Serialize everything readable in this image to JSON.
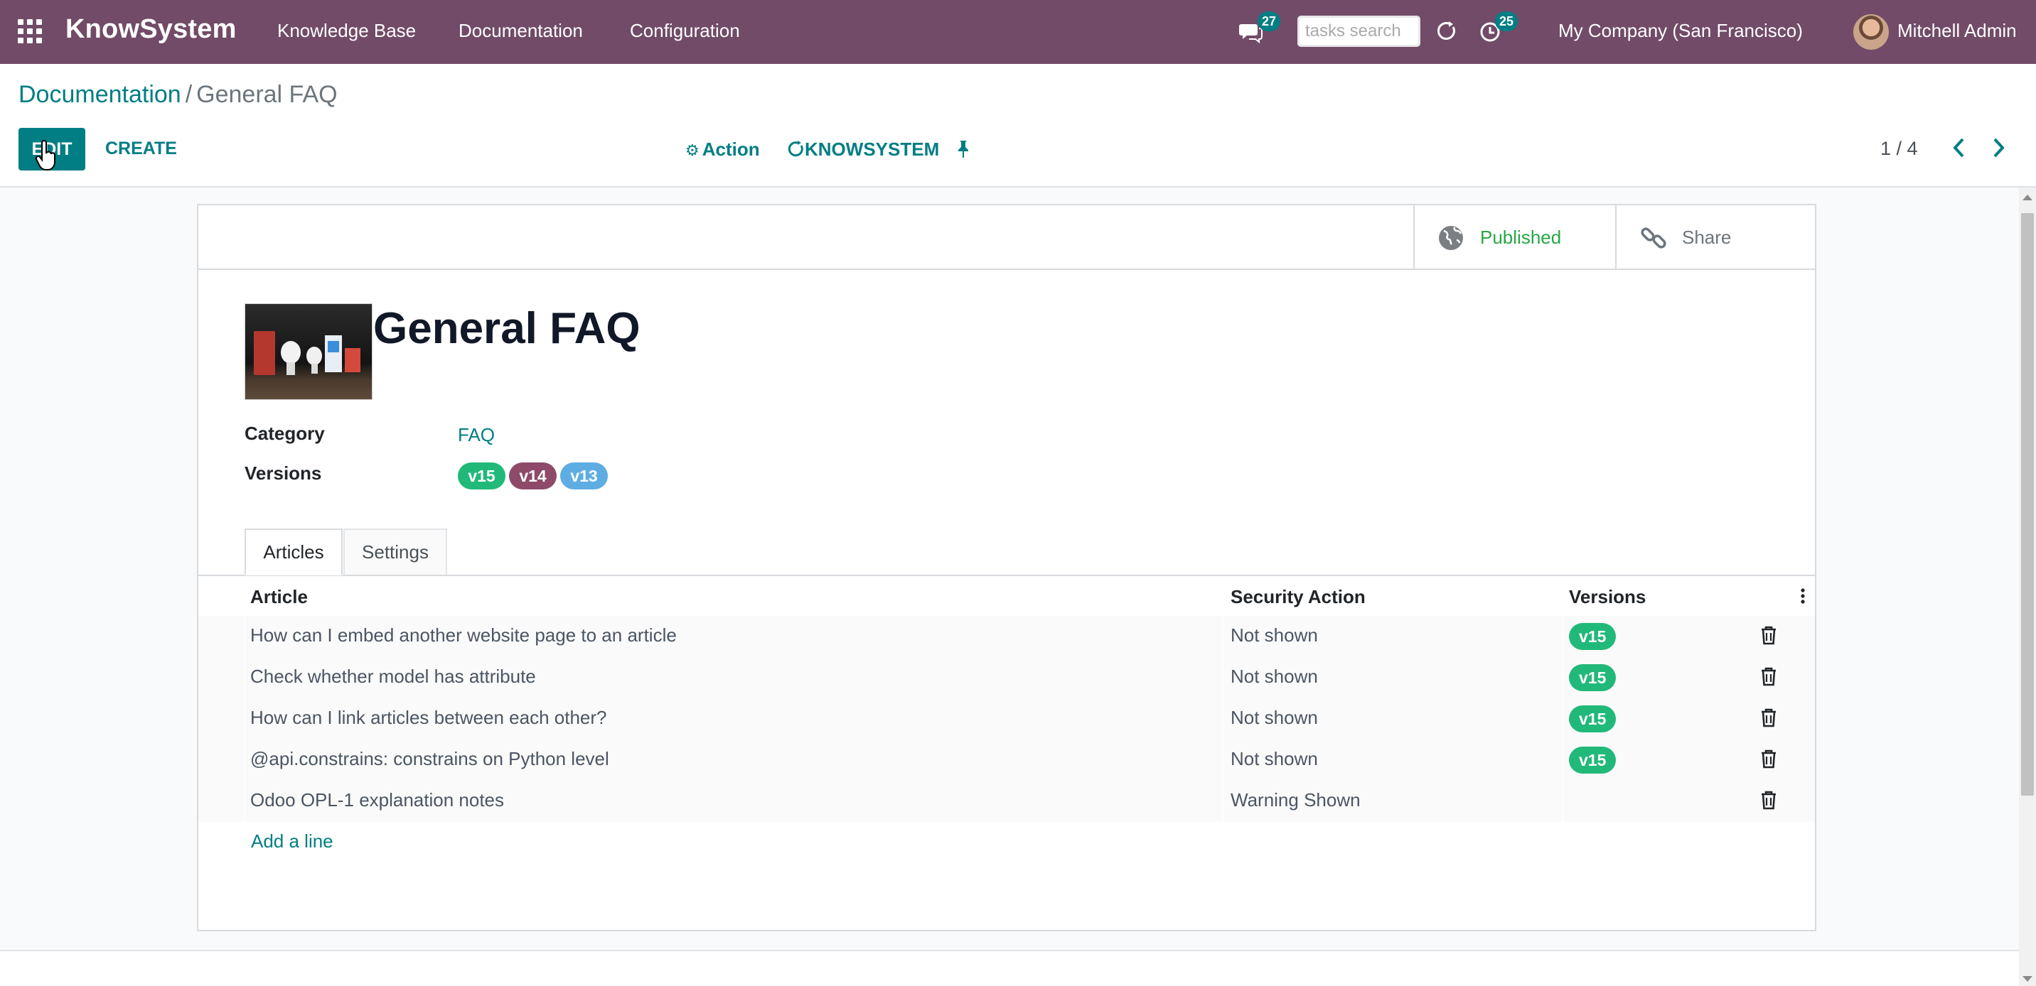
{
  "navbar": {
    "brand": "KnowSystem",
    "menus": [
      "Knowledge Base",
      "Documentation",
      "Configuration"
    ],
    "messages_count": "27",
    "tasks_search_placeholder": "tasks search",
    "activities_count": "25",
    "company": "My Company (San Francisco)",
    "user": "Mitchell Admin"
  },
  "breadcrumb": {
    "parent": "Documentation",
    "separator": "/",
    "current": "General FAQ"
  },
  "control_panel": {
    "edit_label": "EDIT",
    "create_label": "CREATE",
    "action_label": "Action",
    "knowsystem_label": "KNOWSYSTEM",
    "pager": "1 / 4"
  },
  "record": {
    "stat_buttons": {
      "published_label": "Published",
      "share_label": "Share"
    },
    "title": "General FAQ",
    "fields": {
      "category_label": "Category",
      "category_value": "FAQ",
      "versions_label": "Versions"
    },
    "version_tags": [
      {
        "label": "v15",
        "color": "#21b979"
      },
      {
        "label": "v14",
        "color": "#8e4a69"
      },
      {
        "label": "v13",
        "color": "#5dade2"
      }
    ],
    "tabs": [
      "Articles",
      "Settings"
    ],
    "grid": {
      "columns": [
        "Article",
        "Security Action",
        "Versions"
      ],
      "rows": [
        {
          "article": "How can I embed another website page to an article",
          "security": "Not shown",
          "version": "v15"
        },
        {
          "article": "Check whether model has attribute",
          "security": "Not shown",
          "version": "v15"
        },
        {
          "article": "How can I link articles between each other?",
          "security": "Not shown",
          "version": "v15"
        },
        {
          "article": "@api.constrains: constrains on Python level",
          "security": "Not shown",
          "version": "v15"
        },
        {
          "article": "Odoo OPL-1 explanation notes",
          "security": "Warning Shown",
          "version": ""
        }
      ],
      "add_line": "Add a line"
    }
  },
  "colors": {
    "navbar": "#714b67",
    "primary": "#017e84",
    "published": "#28a745"
  }
}
